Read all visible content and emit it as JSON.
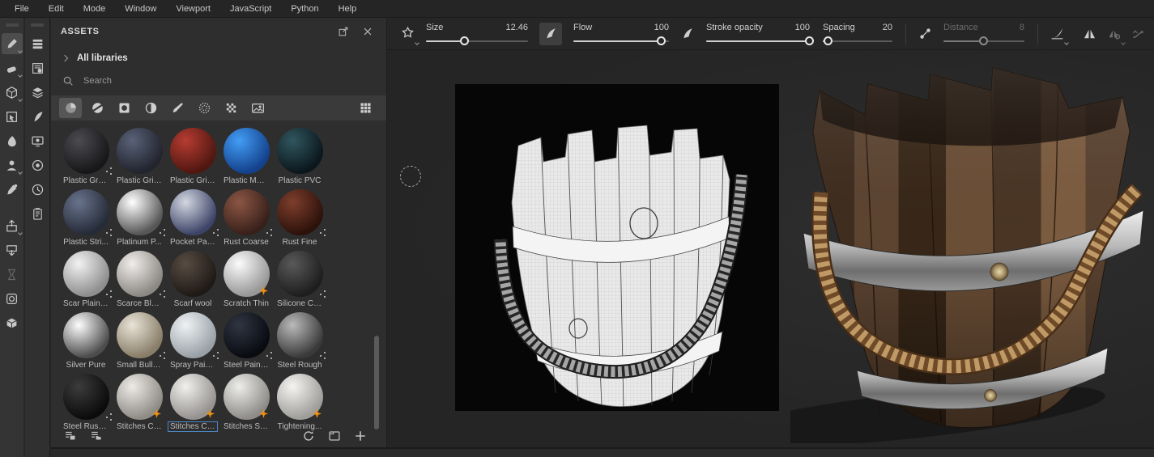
{
  "menu_bar": {
    "items": [
      "File",
      "Edit",
      "Mode",
      "Window",
      "Viewport",
      "JavaScript",
      "Python",
      "Help"
    ]
  },
  "toolbar": {
    "size": {
      "label": "Size",
      "value": "12.46"
    },
    "flow": {
      "label": "Flow",
      "value": "100"
    },
    "stroke_opacity": {
      "label": "Stroke opacity",
      "value": "100"
    },
    "spacing": {
      "label": "Spacing",
      "value": "20"
    },
    "distance": {
      "label": "Distance",
      "value": "8"
    },
    "icons": [
      "brush-stamp",
      "pen-pressure-size",
      "pen-pressure-flow",
      "lazy-mouse",
      "falloff-curve",
      "mirror-symmetry",
      "radial-symmetry",
      "lazy-mouse-path"
    ]
  },
  "tool_sidebar": {
    "items": [
      {
        "name": "paint-brush",
        "selected": true,
        "chevron": true
      },
      {
        "name": "eraser",
        "chevron": true
      },
      {
        "name": "projection",
        "chevron": true
      },
      {
        "name": "polygon-fill"
      },
      {
        "name": "smudge"
      },
      {
        "name": "clone",
        "chevron": true
      },
      {
        "name": "material-picker"
      },
      {
        "name": "export",
        "chevron": true,
        "gap": true
      },
      {
        "name": "import-asset"
      },
      {
        "name": "hourglass",
        "disabled": true
      },
      {
        "name": "bake"
      },
      {
        "name": "package"
      }
    ]
  },
  "panel_sidebar": {
    "items": [
      {
        "name": "texture-set-list"
      },
      {
        "name": "texture-set-settings"
      },
      {
        "name": "layers"
      },
      {
        "name": "effects"
      },
      {
        "name": "display-settings"
      },
      {
        "name": "shader-settings"
      },
      {
        "name": "history"
      },
      {
        "name": "properties"
      }
    ]
  },
  "assets_panel": {
    "title": "ASSETS",
    "library": "All libraries",
    "search_placeholder": "Search",
    "filter_icons": [
      {
        "name": "materials",
        "selected": true
      },
      {
        "name": "smart-materials"
      },
      {
        "name": "smart-masks"
      },
      {
        "name": "filters"
      },
      {
        "name": "brushes"
      },
      {
        "name": "alphas"
      },
      {
        "name": "textures"
      },
      {
        "name": "environments"
      }
    ],
    "view_icon": "grid-view",
    "footer_icons": [
      "shelf-list",
      "shelf-folders",
      "refresh",
      "new-shelf",
      "add-asset"
    ],
    "items": [
      {
        "label": "Plastic Grai...",
        "hi": "#4c4c50",
        "base": "#17171a",
        "badge": "dots"
      },
      {
        "label": "Plastic Grid...",
        "hi": "#596278",
        "base": "#22242e",
        "badge": ""
      },
      {
        "label": "Plastic Grid...",
        "hi": "#b63c31",
        "base": "#501711",
        "badge": ""
      },
      {
        "label": "Plastic Mat...",
        "hi": "#429df5",
        "base": "#14418c",
        "badge": ""
      },
      {
        "label": "Plastic PVC",
        "hi": "#30565f",
        "base": "#0b171c",
        "badge": ""
      },
      {
        "label": "Plastic Stri...",
        "hi": "#68738c",
        "base": "#262b38",
        "badge": "dots"
      },
      {
        "label": "Platinum P...",
        "hi": "#ffffff",
        "base": "#565656",
        "badge": "dots"
      },
      {
        "label": "Pocket Pat...",
        "hi": "#d2d7e0",
        "base": "#3d4468",
        "badge": "dots"
      },
      {
        "label": "Rust Coarse",
        "hi": "#8c5644",
        "base": "#38201a",
        "badge": "dots"
      },
      {
        "label": "Rust Fine",
        "hi": "#7e3e2c",
        "base": "#2c120b",
        "badge": "dots"
      },
      {
        "label": "Scar Plain ...",
        "hi": "#f2f2f2",
        "base": "#8e8e8e",
        "badge": "dots"
      },
      {
        "label": "Scarce Blo...",
        "hi": "#f0eeec",
        "base": "#8c8883",
        "badge": "dots"
      },
      {
        "label": "Scarf wool",
        "hi": "#584c43",
        "base": "#1f1a16",
        "badge": ""
      },
      {
        "label": "Scratch Thin",
        "hi": "#fbfbfb",
        "base": "#979797",
        "badge": "star"
      },
      {
        "label": "Silicone Coat",
        "hi": "#595959",
        "base": "#1e1e1e",
        "badge": "dots"
      },
      {
        "label": "Silver Pure",
        "hi": "#fdfdfd",
        "base": "#4c4c4c",
        "badge": ""
      },
      {
        "label": "Small Bulle...",
        "hi": "#e9e3d7",
        "base": "#887d68",
        "badge": "dots"
      },
      {
        "label": "Spray Pain...",
        "hi": "#eff2f4",
        "base": "#99a1a7",
        "badge": "dots"
      },
      {
        "label": "Steel Painted",
        "hi": "#303542",
        "base": "#090b11",
        "badge": "dots"
      },
      {
        "label": "Steel Rough",
        "hi": "#bababa",
        "base": "#3a3a3a",
        "badge": "dots"
      },
      {
        "label": "Steel Rust ...",
        "hi": "#3c3c3c",
        "base": "#0b0b0b",
        "badge": "dots"
      },
      {
        "label": "Stitches Co...",
        "hi": "#edebe7",
        "base": "#8f8b85",
        "badge": "star"
      },
      {
        "label": "Stitches Cr...",
        "hi": "#f1f0ed",
        "base": "#95928f",
        "badge": "star",
        "selected": true
      },
      {
        "label": "Stitches Str...",
        "hi": "#ededeb",
        "base": "#8e8c88",
        "badge": "star"
      },
      {
        "label": "Tightening...",
        "hi": "#f5f4f2",
        "base": "#9f9d99",
        "badge": "star"
      }
    ]
  }
}
